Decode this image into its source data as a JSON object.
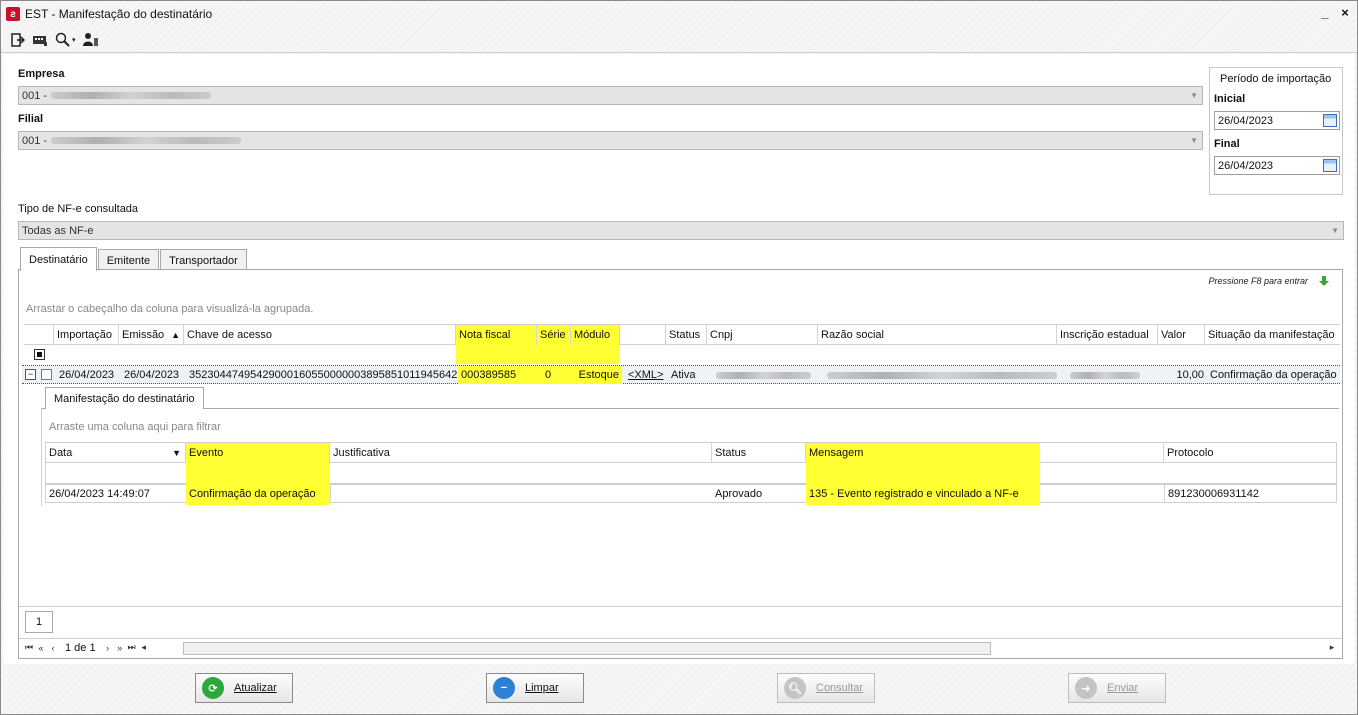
{
  "window": {
    "title": "EST - Manifestação do destinatário",
    "minimize": "_",
    "close": "×"
  },
  "toolbar": {
    "icons": [
      "exit-icon",
      "card-reader-icon",
      "magnifier-icon",
      "user-icon"
    ],
    "dropdown": "▾"
  },
  "empresa": {
    "label": "Empresa",
    "value": "001 -"
  },
  "filial": {
    "label": "Filial",
    "value": "001 -"
  },
  "periodo": {
    "title": "Período de importação",
    "inicial_label": "Inicial",
    "inicial": "26/04/2023",
    "final_label": "Final",
    "final": "26/04/2023"
  },
  "tipo": {
    "label": "Tipo de NF-e consultada",
    "value": "Todas as NF-e"
  },
  "tabs": [
    "Destinatário",
    "Emitente",
    "Transportador"
  ],
  "grid": {
    "f8_hint": "Pressione F8 para entrar",
    "group_hint": "Arrastar o cabeçalho da coluna para visualizá-la agrupada.",
    "columns": [
      "Importação",
      "Emissão",
      "Chave de acesso",
      "Nota fiscal",
      "Série",
      "Módulo",
      "",
      "Status",
      "Cnpj",
      "Razão social",
      "Inscrição estadual",
      "Valor",
      "Situação da manifestação"
    ],
    "sort_indicator": "▲",
    "row": {
      "importacao": "26/04/2023",
      "emissao": "26/04/2023",
      "chave": "35230447495429000160550000003895851011945642",
      "nota": "000389585",
      "serie": "0",
      "modulo": "Estoque",
      "xml": "<XML>",
      "status": "Ativa",
      "valor": "10,00",
      "situacao": "Confirmação da operação"
    }
  },
  "detail": {
    "tab": "Manifestação do destinatário",
    "filter_hint": "Arraste uma coluna aqui para filtrar",
    "columns": [
      "Data",
      "Evento",
      "Justificativa",
      "Status",
      "Mensagem",
      "Protocolo"
    ],
    "sort_indicator": "▼",
    "row": {
      "data": "26/04/2023 14:49:07",
      "evento": "Confirmação da operação",
      "justificativa": "",
      "status": "Aprovado",
      "mensagem": "135 - Evento registrado e vinculado a NF-e",
      "protocolo": "891230006931142"
    }
  },
  "pager": {
    "page": "1",
    "info": "1 de 1"
  },
  "buttons": {
    "atualizar": "Atualizar",
    "limpar": "Limpar",
    "consultar": "Consultar",
    "enviar": "Enviar"
  },
  "colors": {
    "highlight": "#ffff33",
    "brand": "#c8102e"
  }
}
